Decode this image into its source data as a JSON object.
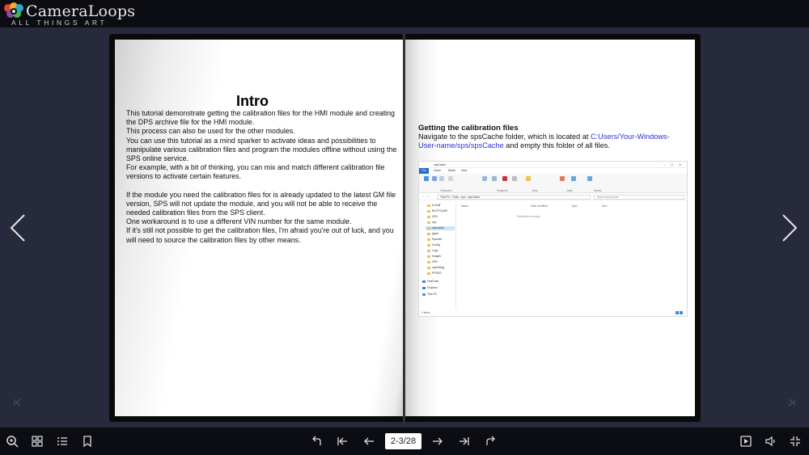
{
  "header": {
    "logo_name": "CameraLoops",
    "logo_tagline": "ALL THINGS ART"
  },
  "left_page": {
    "title": "Intro",
    "paragraphs": [
      "This tutorial demonstrate getting the calibration files for the HMI module and creating the DPS archive file for the HMI module.",
      "This process can also be used for the other modules.",
      "You can use this tutorial as a mind sparker to activate ideas and possibilities to manipulate various calibration files and program the modules offline without using the SPS online service.",
      "For example, with a bit of thinking, you can mix and match different calibration file versions to activate certain features.",
      "",
      "If the module you need the calibration files for is already updated to the latest GM file version, SPS will not update the module, and you will not be able to receive the needed calibration files from the SPS client.",
      "One workaround is to use a different VIN number for the same module.",
      "If it's still not possible to get the calibration files, I'm afraid you're out of luck, and you will need to source the calibration files by other means."
    ]
  },
  "right_page": {
    "heading": "Getting the calibration files",
    "text_before": "Navigate to the spsCache folder, which is located at ",
    "path": "C:Users/Your-Windows-User-name/sps/spsCache",
    "text_after": " and empty this folder of all files.",
    "screenshot": {
      "window_title": "spsCache",
      "tabs": [
        "File",
        "Home",
        "Share",
        "View"
      ],
      "ribbon_groups": [
        "Clipboard",
        "Organize",
        "New",
        "Open",
        "Select"
      ],
      "address": "This PC › Tools › sps › spsCache",
      "search_placeholder": "Search spsCache",
      "nav_items": [
        "A-Stuff",
        "BOOTCAMP",
        "DRV",
        "sps",
        "spsCache",
        "types",
        "Spanish",
        "Config",
        "Logs",
        "Images",
        "DRV",
        "spsDebug",
        "PPSDS"
      ],
      "nav_items_more": [
        "OneDrive",
        "Dropbox",
        "This PC"
      ],
      "columns": [
        "Name",
        "Date modified",
        "Type",
        "Size"
      ],
      "empty_message": "This folder is empty.",
      "status": "0 items"
    }
  },
  "toolbar": {
    "page_indicator": "2-3/28"
  },
  "colors": {
    "background": "#272a3d",
    "bar": "#0c0d12",
    "link": "#3030d8"
  }
}
